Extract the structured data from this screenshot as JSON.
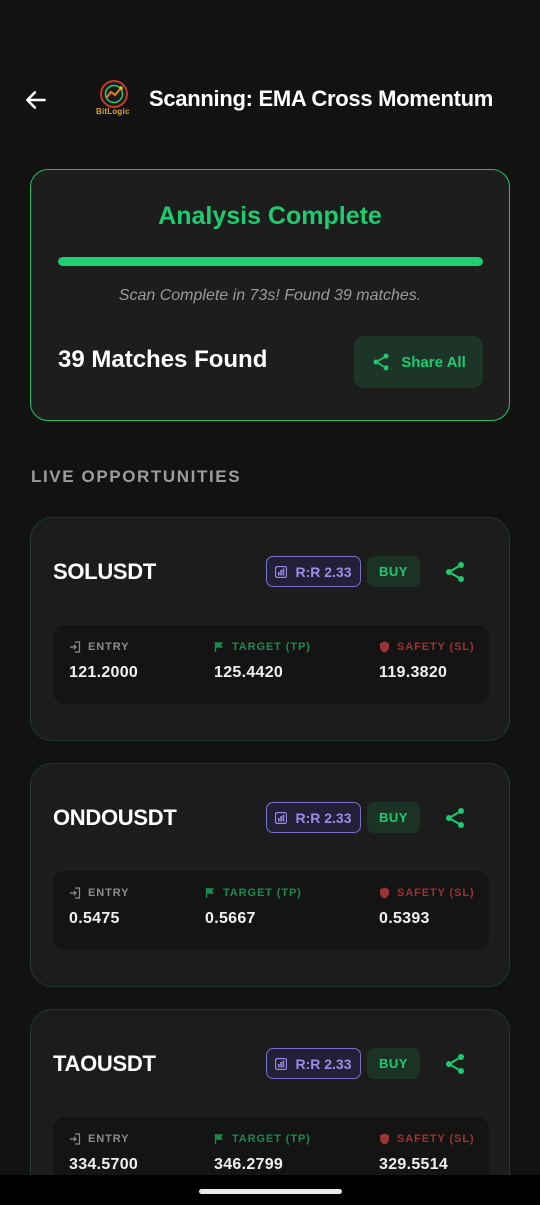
{
  "header": {
    "title": "Scanning: EMA Cross Momentum",
    "logo_text": "BitLogic"
  },
  "status": {
    "title": "Analysis Complete",
    "progress": 1.0,
    "subtitle": "Scan Complete in 73s! Found 39 matches.",
    "matches": "39 Matches Found",
    "share_all_label": "Share All"
  },
  "section_label": "LIVE OPPORTUNITIES",
  "labels": {
    "entry": "ENTRY",
    "target": "TARGET (TP)",
    "safety": "SAFETY (SL)"
  },
  "opportunities": [
    {
      "symbol": "SOLUSDT",
      "rr": "R:R 2.33",
      "signal": "BUY",
      "entry": "121.2000",
      "target": "125.4420",
      "safety": "119.3820"
    },
    {
      "symbol": "ONDOUSDT",
      "rr": "R:R 2.33",
      "signal": "BUY",
      "entry": "0.5475",
      "target": "0.5667",
      "safety": "0.5393"
    },
    {
      "symbol": "TAOUSDT",
      "rr": "R:R 2.33",
      "signal": "BUY",
      "entry": "334.5700",
      "target": "346.2799",
      "safety": "329.5514"
    }
  ],
  "colors": {
    "accent": "#1ecb6f",
    "background": "#121212",
    "card": "#1c1c1c",
    "rr_badge": "#9a8fe8",
    "target": "#1c8a4e",
    "safety": "#9b3434"
  },
  "icons": {
    "back": "arrow-left-icon",
    "share": "share-icon",
    "entry": "login-icon",
    "target": "flag-icon",
    "safety": "shield-icon",
    "rr": "chart-icon"
  }
}
